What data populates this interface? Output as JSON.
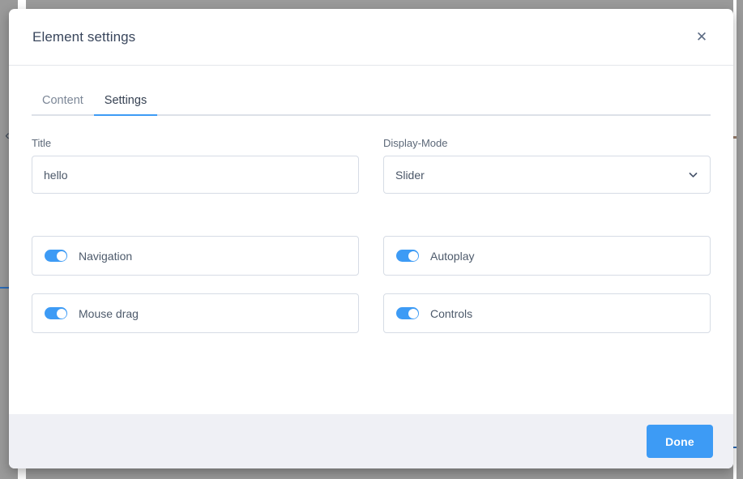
{
  "backdrop": {
    "left_chevron_icon": "‹"
  },
  "modal": {
    "title": "Element settings",
    "close_label": "✕",
    "tabs": [
      {
        "label": "Content",
        "active": false
      },
      {
        "label": "Settings",
        "active": true
      }
    ],
    "fields": {
      "title": {
        "label": "Title",
        "value": "hello",
        "placeholder": "Title"
      },
      "display_mode": {
        "label": "Display-Mode",
        "value": "Slider",
        "options": [
          "Slider"
        ],
        "chevron_icon": "chevron-down"
      }
    },
    "toggles": [
      {
        "label": "Navigation",
        "on": true
      },
      {
        "label": "Autoplay",
        "on": true
      },
      {
        "label": "Mouse drag",
        "on": true
      },
      {
        "label": "Controls",
        "on": true
      }
    ],
    "footer": {
      "done_label": "Done"
    }
  },
  "colors": {
    "accent": "#3d9bf5",
    "title_text": "#39465c",
    "label_text": "#5c6878",
    "border": "#d6dce5",
    "footer_bg": "#eff0f5",
    "backdrop": "#9a9a9a"
  }
}
